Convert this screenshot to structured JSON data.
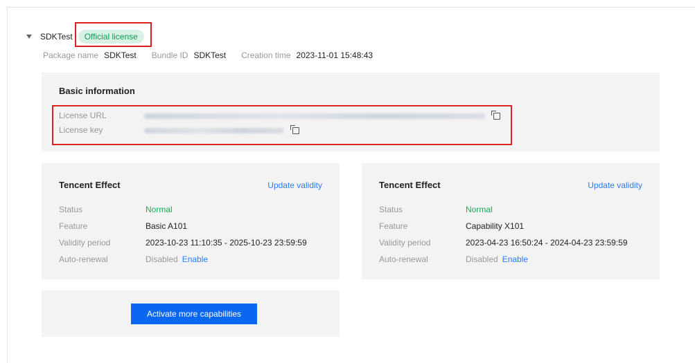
{
  "app": {
    "name": "SDKTest",
    "license_badge": "Official license"
  },
  "meta": {
    "package_label": "Package name",
    "package_value": "SDKTest",
    "bundle_label": "Bundle ID",
    "bundle_value": "SDKTest",
    "creation_label": "Creation time",
    "creation_value": "2023-11-01 15:48:43"
  },
  "basic": {
    "title": "Basic information",
    "license_url_label": "License URL",
    "license_key_label": "License key"
  },
  "cards": [
    {
      "title": "Tencent Effect",
      "update_label": "Update validity",
      "status_label": "Status",
      "status_value": "Normal",
      "feature_label": "Feature",
      "feature_value": "Basic A101",
      "validity_label": "Validity period",
      "validity_value": "2023-10-23 11:10:35 - 2025-10-23 23:59:59",
      "renewal_label": "Auto-renewal",
      "renewal_value": "Disabled",
      "renewal_action": "Enable"
    },
    {
      "title": "Tencent Effect",
      "update_label": "Update validity",
      "status_label": "Status",
      "status_value": "Normal",
      "feature_label": "Feature",
      "feature_value": "Capability X101",
      "validity_label": "Validity period",
      "validity_value": "2023-04-23 16:50:24 - 2024-04-23 23:59:59",
      "renewal_label": "Auto-renewal",
      "renewal_value": "Disabled",
      "renewal_action": "Enable"
    }
  ],
  "activate_button": "Activate more capabilities",
  "colors": {
    "accent": "#0a67f2",
    "link": "#2b7cf6",
    "success": "#1ea858",
    "badge_bg": "#d9f2e6",
    "highlight": "#e0201d"
  },
  "icons": {
    "expand": "caret-down-icon",
    "copy": "copy-icon"
  }
}
